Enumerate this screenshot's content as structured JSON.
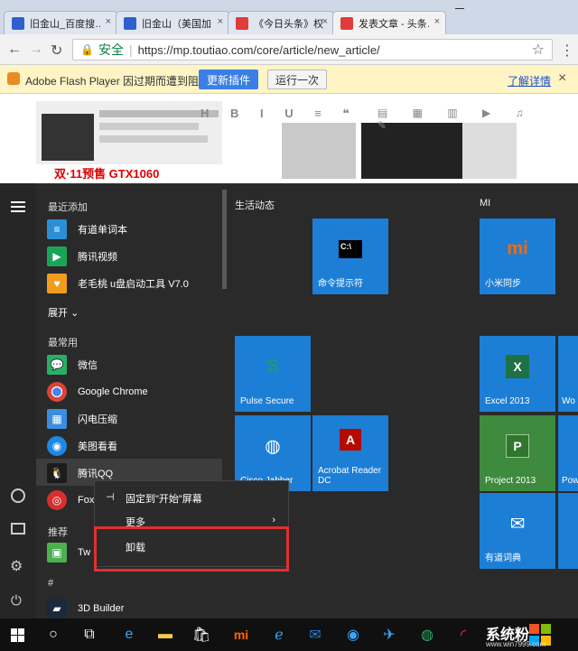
{
  "browser": {
    "tabs": [
      {
        "title": "旧金山_百度搜…",
        "close": "×"
      },
      {
        "title": "旧金山（美国加…",
        "close": "×"
      },
      {
        "title": "《今日头条》权…",
        "close": "×"
      },
      {
        "title": "发表文章 - 头条…",
        "close": "×"
      }
    ],
    "nav": {
      "back": "←",
      "forward": "→",
      "reload": "↻"
    },
    "address": {
      "secure_label": "安全",
      "url": "https://mp.toutiao.com/core/article/new_article/"
    },
    "star": "☆",
    "menu": "⋮"
  },
  "flash_bar": {
    "message": "Adobe Flash Player 因过期而遭到阻止。",
    "update_button": "更新插件",
    "run_once_button": "运行一次",
    "learn_more": "了解详情",
    "close": "×"
  },
  "web_content": {
    "ad_text": "双·11预售  GTX1060"
  },
  "start_menu": {
    "recent_header": "最近添加",
    "recent": [
      {
        "label": "有道单词本",
        "icon": "youdao-dict-icon",
        "color": "#2a8fd6"
      },
      {
        "label": "腾讯视频",
        "icon": "tencent-video-icon",
        "color": "#1aa556"
      },
      {
        "label": "老毛桃 u盘启动工具 V7.0",
        "icon": "laomaotao-icon",
        "color": "#f29c1f"
      }
    ],
    "expand_label": "展开",
    "frequent_header": "最常用",
    "frequent": [
      {
        "label": "微信",
        "icon": "wechat-icon",
        "color": "#2aae67"
      },
      {
        "label": "Google Chrome",
        "icon": "chrome-icon",
        "color": "#dd4b39"
      },
      {
        "label": "闪电压缩",
        "icon": "flash-zip-icon",
        "color": "#3b8de0"
      },
      {
        "label": "美图看看",
        "icon": "meitu-viewer-icon",
        "color": "#1e88e5"
      },
      {
        "label": "腾讯QQ",
        "icon": "qq-icon",
        "color": "#1c1c1c"
      },
      {
        "label": "Fox",
        "icon": "foxmail-icon",
        "color": "#d62f2f"
      }
    ],
    "suggested_header": "推荐",
    "suggested": [
      {
        "label": "Tw",
        "icon": "suggested-app-icon",
        "color": "#4caf50"
      }
    ],
    "hash_header": "#",
    "hash_apps": [
      {
        "label": "3D Builder",
        "icon": "3d-builder-icon",
        "color": "#1b2a3a"
      }
    ],
    "group_life": "生活动态",
    "group_mi": "MI",
    "tiles": [
      {
        "label": "命令提示符",
        "color": "#1d7ed6",
        "icon": "cmd-icon"
      },
      {
        "label": "小米同步",
        "color": "#1d7ed6",
        "icon": "mi-icon"
      },
      {
        "label": "Pulse Secure",
        "color": "#1d7ed6",
        "icon": "pulse-secure-icon"
      },
      {
        "label": "Excel 2013",
        "color": "#1d7ed6",
        "icon": "excel-icon"
      },
      {
        "label": "Wo",
        "color": "#1d7ed6",
        "icon": "word-icon"
      },
      {
        "label": "Cisco Jabber",
        "color": "#1d7ed6",
        "icon": "jabber-icon"
      },
      {
        "label": "Acrobat Reader DC",
        "color": "#1d7ed6",
        "icon": "acrobat-icon"
      },
      {
        "label": "Project 2013",
        "color": "#3e8a3e",
        "icon": "project-icon"
      },
      {
        "label": "Pow",
        "color": "#1d7ed6",
        "icon": "powerpoint-icon"
      },
      {
        "label": "有道词典",
        "color": "#1d7ed6",
        "icon": "youdao-icon"
      }
    ]
  },
  "context_menu": {
    "pin_label": "固定到\"开始\"屏幕",
    "more_label": "更多",
    "uninstall_label": "卸载"
  },
  "taskbar": {
    "watermark": "系统粉",
    "watermark_url": "www.win7999.com"
  }
}
